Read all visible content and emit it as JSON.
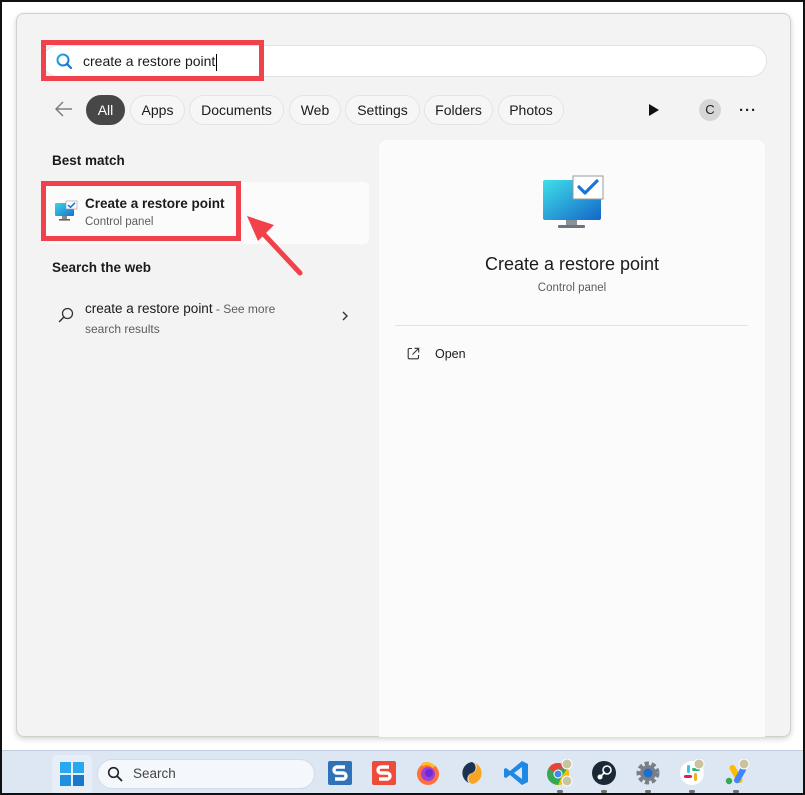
{
  "search": {
    "query": "create a restore point"
  },
  "filters": {
    "chips": [
      {
        "label": "All",
        "active": true
      },
      {
        "label": "Apps",
        "active": false
      },
      {
        "label": "Documents",
        "active": false
      },
      {
        "label": "Web",
        "active": false
      },
      {
        "label": "Settings",
        "active": false
      },
      {
        "label": "Folders",
        "active": false
      },
      {
        "label": "Photos",
        "active": false
      }
    ],
    "avatar_initial": "C",
    "more_label": "···"
  },
  "results": {
    "best_match_heading": "Best match",
    "best_match": {
      "title": "Create a restore point",
      "subtitle": "Control panel",
      "icon": "monitor-check-icon"
    },
    "web_heading": "Search the web",
    "web_result": {
      "query": "create a restore point",
      "suffix": " - See more",
      "subtitle": "search results",
      "icon": "search-icon"
    }
  },
  "detail": {
    "title": "Create a restore point",
    "subtitle": "Control panel",
    "actions": [
      {
        "label": "Open",
        "icon": "open-external-icon"
      }
    ]
  },
  "taskbar": {
    "search_placeholder": "Search",
    "apps": [
      {
        "name": "snagit-editor",
        "icon": "snagit-blue-icon"
      },
      {
        "name": "snagit",
        "icon": "snagit-red-icon"
      },
      {
        "name": "firefox",
        "icon": "firefox-icon"
      },
      {
        "name": "simplenote",
        "icon": "simplenote-icon"
      },
      {
        "name": "vscode",
        "icon": "vscode-icon"
      },
      {
        "name": "chrome",
        "icon": "chrome-icon"
      },
      {
        "name": "steam",
        "icon": "steam-icon"
      },
      {
        "name": "settings",
        "icon": "settings-gear-icon"
      },
      {
        "name": "slack",
        "icon": "slack-icon"
      },
      {
        "name": "google-ads",
        "icon": "google-ads-icon"
      }
    ]
  },
  "annotation_colors": {
    "highlight": "#f1414b",
    "accent": "#0067c0"
  }
}
